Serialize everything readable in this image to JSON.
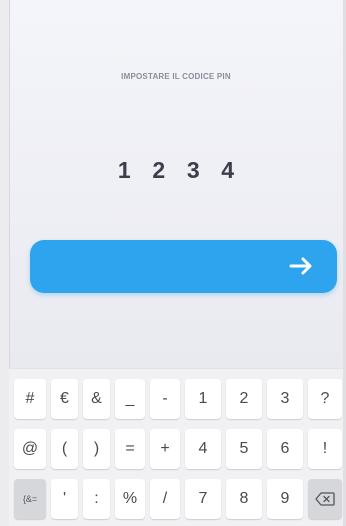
{
  "title": "IMPOSTARE IL CODICE PIN",
  "pin_digits": [
    "1",
    "2",
    "3",
    "4"
  ],
  "next_button_icon": "arrow-right-icon",
  "colors": {
    "accent": "#2ea4ee",
    "pin_text": "#3b3e4b",
    "title_text": "#8a8d9a"
  },
  "keyboard": {
    "row1": [
      "#",
      "€",
      "&",
      "_",
      "-",
      "1",
      "2",
      "3",
      "?"
    ],
    "row2": [
      "@",
      "(",
      ")",
      "=",
      "+",
      "4",
      "5",
      "6",
      "!"
    ],
    "row3": [
      "{&=",
      "'",
      ":",
      "%",
      "/",
      "7",
      "8",
      "9"
    ],
    "backspace_icon": "backspace-icon"
  }
}
